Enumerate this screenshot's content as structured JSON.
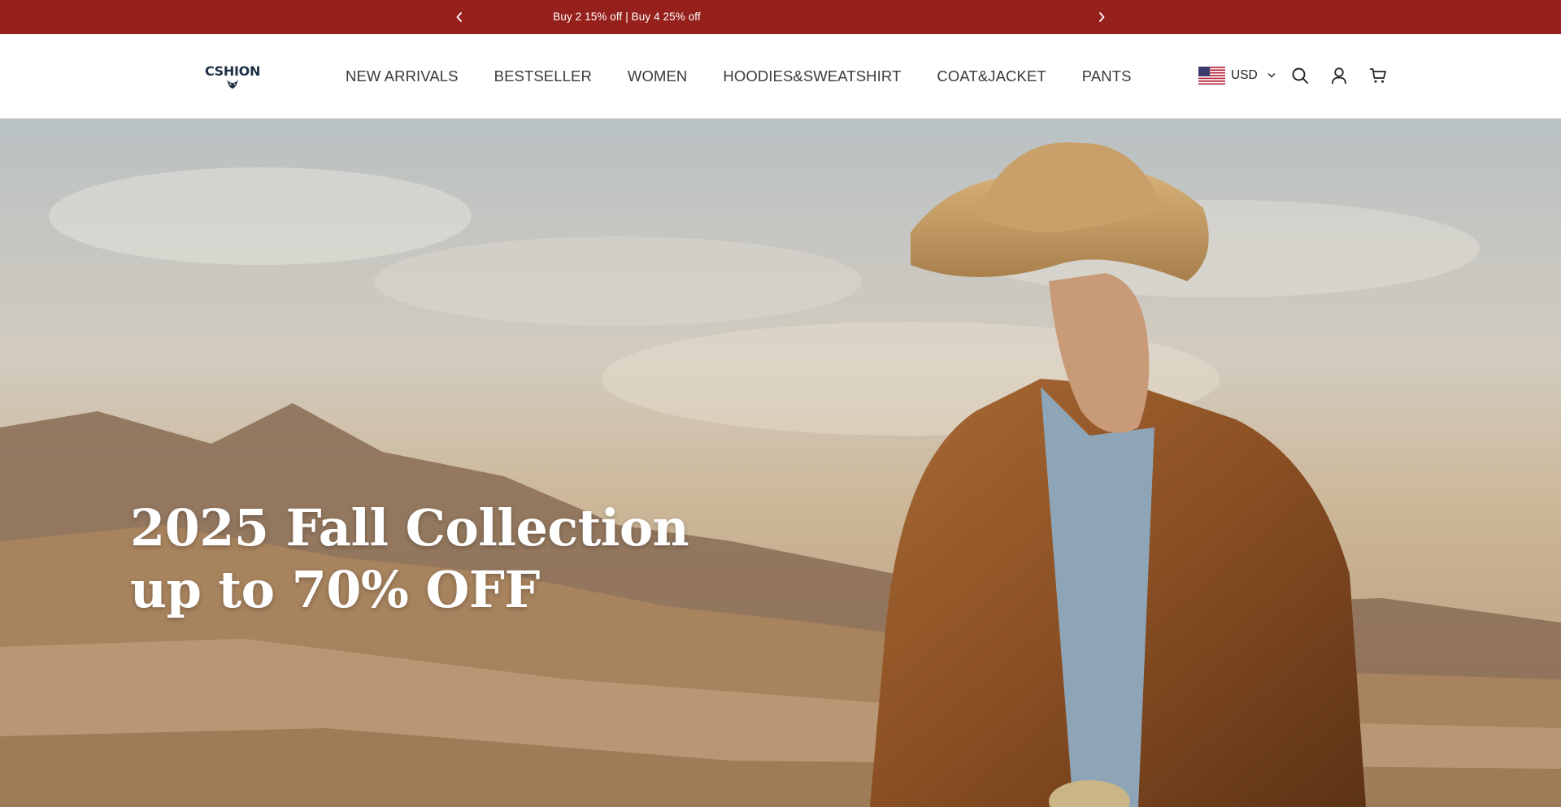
{
  "announcement": {
    "message": "Buy 2 15% off | Buy 4 25% off",
    "background_color": "#96201b",
    "prev_icon": "chevron-left-icon",
    "next_icon": "chevron-right-icon"
  },
  "header": {
    "logo_text": "CSHION",
    "nav": [
      {
        "label": "NEW ARRIVALS"
      },
      {
        "label": "BESTSELLER"
      },
      {
        "label": "WOMEN"
      },
      {
        "label": "HOODIES&SWEATSHIRT"
      },
      {
        "label": "COAT&JACKET"
      },
      {
        "label": "PANTS"
      }
    ],
    "currency": {
      "code": "USD",
      "flag_icon": "us-flag-icon",
      "dropdown_icon": "chevron-down-icon"
    },
    "icons": {
      "search": "search-icon",
      "account": "user-icon",
      "cart": "cart-icon"
    }
  },
  "hero": {
    "line1": "2025 Fall Collection",
    "line2": "up to 70% OFF"
  }
}
